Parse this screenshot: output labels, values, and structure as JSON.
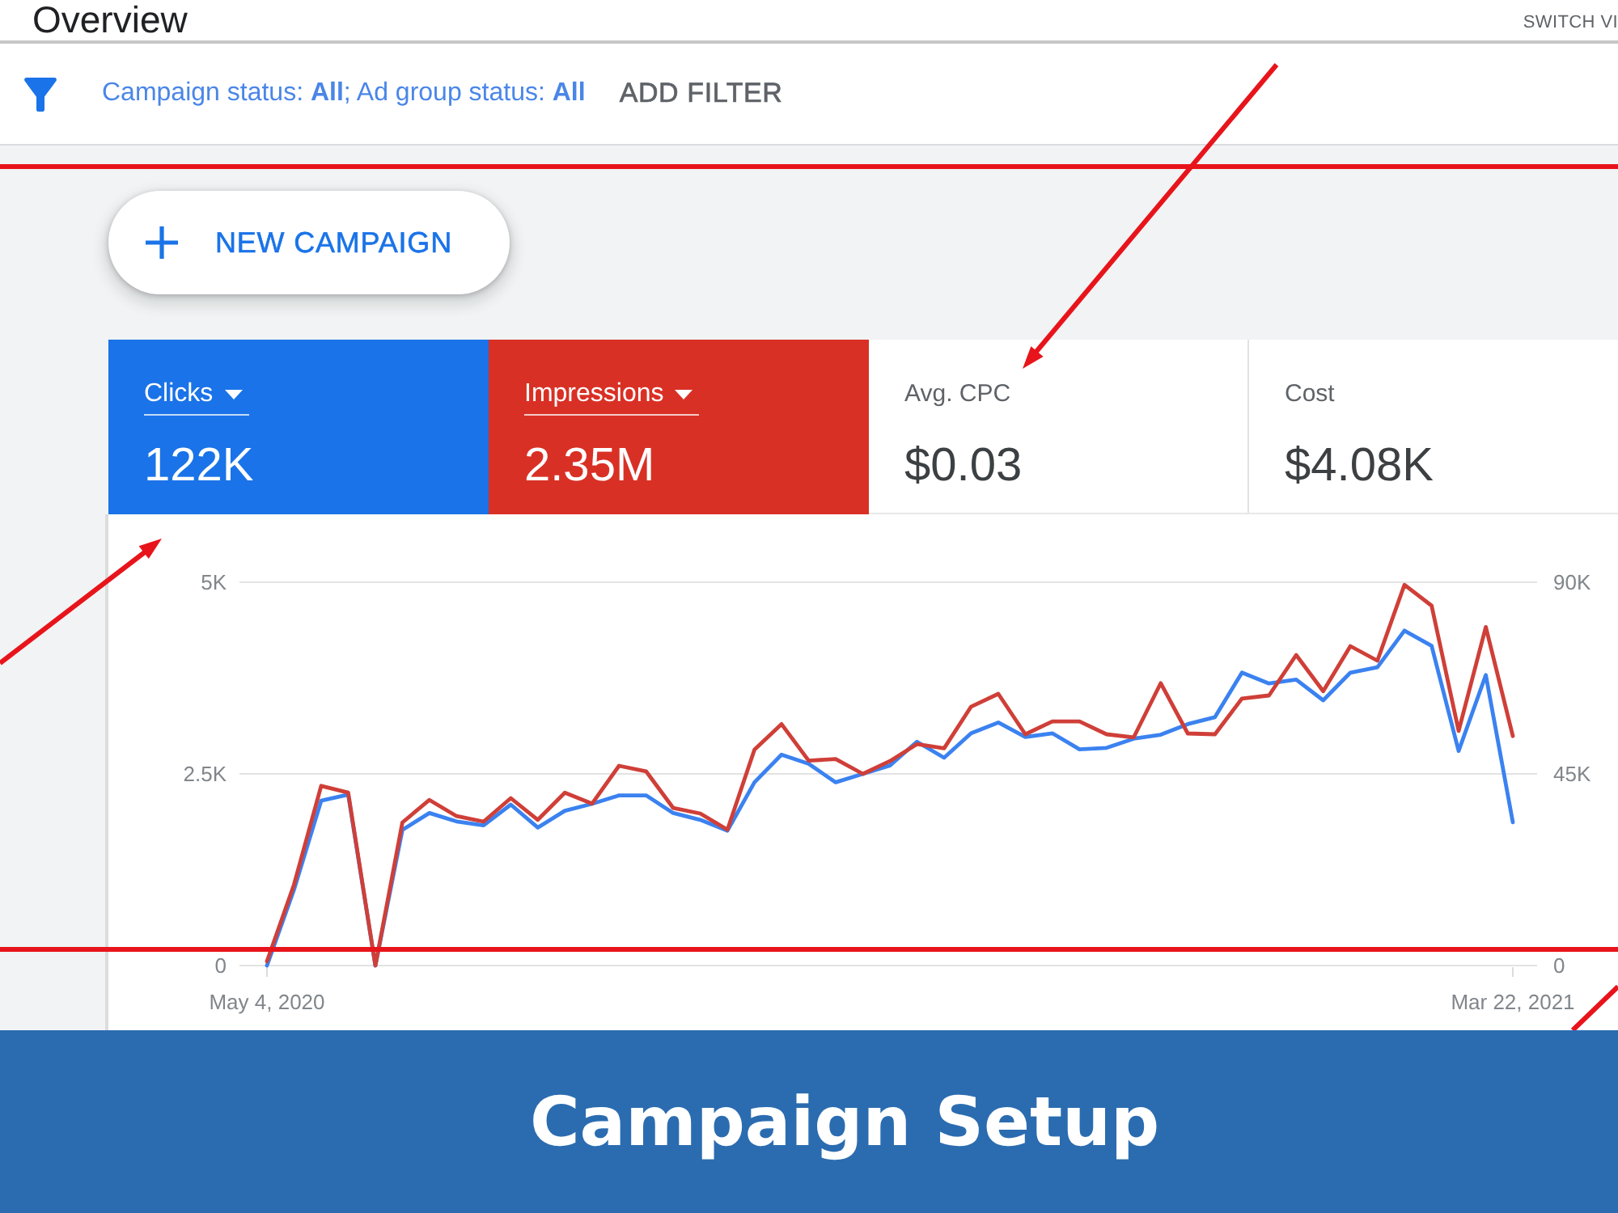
{
  "header": {
    "title": "Overview",
    "switch_view": "SWITCH VI"
  },
  "filter_bar": {
    "summary": "Campaign status: **All**; Ad group status: **All**",
    "add_filter": "ADD FILTER"
  },
  "new_campaign": {
    "label": "NEW CAMPAIGN"
  },
  "metrics": [
    {
      "label": "Clicks",
      "value": "122K",
      "selected": true,
      "color": "#1a73e8"
    },
    {
      "label": "Impressions",
      "value": "2.35M",
      "selected": true,
      "color": "#d93025"
    },
    {
      "label": "Avg. CPC",
      "value": "$0.03",
      "selected": false
    },
    {
      "label": "Cost",
      "value": "$4.08K",
      "selected": false
    }
  ],
  "chart": {
    "chart_data": [
      {
        "type": "line",
        "categories": [
          "May 4, 2020",
          null,
          null,
          null,
          null,
          null,
          null,
          null,
          null,
          null,
          null,
          null,
          null,
          null,
          null,
          null,
          null,
          null,
          null,
          null,
          null,
          null,
          null,
          null,
          null,
          null,
          null,
          null,
          null,
          null,
          null,
          null,
          null,
          null,
          null,
          null,
          null,
          null,
          null,
          null,
          null,
          null,
          null,
          null,
          null,
          null,
          "Mar 22, 2021"
        ],
        "series": [
          {
            "color": "#3b82f0",
            "values": [
              0,
              990,
              2150,
              2230,
              0,
              1770,
              1990,
              1880,
              1830,
              2100,
              1800,
              2020,
              2110,
              2220,
              2220,
              1990,
              1900,
              1760,
              2390,
              2750,
              2630,
              2390,
              2500,
              2610,
              2920,
              2710,
              3030,
              3170,
              2980,
              3030,
              2820,
              2840,
              2960,
              3010,
              3150,
              3240,
              3820,
              3680,
              3730,
              3460,
              3820,
              3890,
              4370,
              4170,
              2800,
              3790,
              1870
            ]
          },
          {
            "color": "#cf3f38",
            "axis": "y2",
            "values": [
              1000,
              19000,
              42200,
              40600,
              0,
              33600,
              38900,
              35100,
              33800,
              39300,
              34200,
              40600,
              38000,
              46900,
              45600,
              37000,
              35700,
              31900,
              50700,
              56700,
              48100,
              48500,
              45000,
              48000,
              52000,
              51000,
              60800,
              63800,
              54300,
              57300,
              57300,
              54300,
              53600,
              66300,
              54500,
              54300,
              62700,
              63400,
              72900,
              64400,
              75000,
              71600,
              89400,
              84500,
              55100,
              79500,
              53900
            ]
          }
        ],
        "ylim": [
          0,
          5000
        ],
        "yticks": [
          {
            "value": 0,
            "label": "0"
          },
          {
            "value": 2500,
            "label": "2.5K"
          },
          {
            "value": 5000,
            "label": "5K"
          }
        ],
        "y2lim": [
          0,
          90000
        ],
        "y2ticks": [
          {
            "value": 0,
            "label": "0"
          },
          {
            "value": 45000,
            "label": "45K"
          },
          {
            "value": 90000,
            "label": "90K"
          }
        ],
        "grid": true
      }
    ]
  },
  "banner": {
    "title": "Campaign Setup"
  }
}
